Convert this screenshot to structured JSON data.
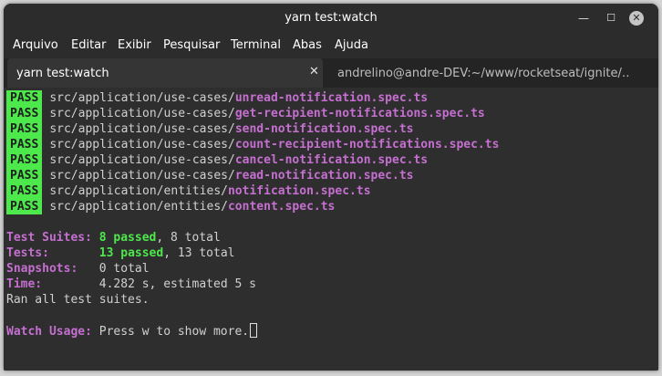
{
  "window": {
    "title": "yarn test:watch",
    "min_glyph": "—",
    "max_glyph": "☐",
    "close_glyph": "✕"
  },
  "menu": [
    {
      "label": "Arquivo"
    },
    {
      "label": "Editar"
    },
    {
      "label": "Exibir"
    },
    {
      "label": "Pesquisar"
    },
    {
      "label": "Terminal"
    },
    {
      "label": "Abas"
    },
    {
      "label": "Ajuda"
    }
  ],
  "tabs": [
    {
      "label": "yarn test:watch",
      "close": "✕"
    },
    {
      "label": "andrelino@andre-DEV:~/www/rocketseat/ignite/…",
      "close": "✕"
    }
  ],
  "terminal": {
    "pass_badge": "PASS",
    "results": [
      {
        "path": "src/application/use-cases/",
        "file": "unread-notification.spec.ts"
      },
      {
        "path": "src/application/use-cases/",
        "file": "get-recipient-notifications.spec.ts"
      },
      {
        "path": "src/application/use-cases/",
        "file": "send-notification.spec.ts"
      },
      {
        "path": "src/application/use-cases/",
        "file": "count-recipient-notifications.spec.ts"
      },
      {
        "path": "src/application/use-cases/",
        "file": "cancel-notification.spec.ts"
      },
      {
        "path": "src/application/use-cases/",
        "file": "read-notification.spec.ts"
      },
      {
        "path": "src/application/entities/",
        "file": "notification.spec.ts"
      },
      {
        "path": "src/application/entities/",
        "file": "content.spec.ts"
      }
    ],
    "summary": {
      "suites_label": "Test Suites:",
      "suites_passed": "8 passed",
      "suites_total": ", 8 total",
      "tests_label": "Tests:",
      "tests_passed": "13 passed",
      "tests_total": ", 13 total",
      "snapshots_label": "Snapshots:",
      "snapshots_value": "0 total",
      "time_label": "Time:",
      "time_value": "4.282 s, estimated 5 s",
      "ran_all": "Ran all test suites."
    },
    "watch": {
      "label": "Watch Usage:",
      "text": " Press w to show more."
    }
  },
  "colors": {
    "pass_bg": "#4de84b",
    "file": "#c56fd0",
    "passed_green": "#4de84b",
    "terminal_bg": "#2e2e2e"
  }
}
